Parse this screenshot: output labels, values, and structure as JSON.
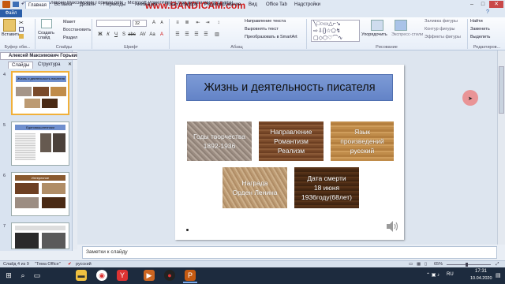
{
  "window": {
    "title": "Алексей Максимович Горький.pptx - Microsoft PowerPoint (Сбой активации продукта)",
    "watermark": "www.BANDICAM.com"
  },
  "ribbon_tabs": [
    "Файл",
    "Главная",
    "Вставка",
    "Дизайн",
    "Переходы",
    "Анимация",
    "Показ слайдов",
    "Рецензирование",
    "Вид",
    "Office Tab",
    "Надстройки"
  ],
  "ribbon": {
    "paste": "Вставить",
    "new_slide": "Создать слайд",
    "layout": "Макет",
    "reset": "Восстановить",
    "section": "Раздел",
    "font_size": "32",
    "text_direction": "Направление текста",
    "align_text": "Выровнять текст",
    "convert_smartart": "Преобразовать в SmartArt",
    "arrange": "Упорядочить",
    "quick_styles": "Экспресс-стили",
    "shape_fill": "Заливка фигуры",
    "shape_outline": "Контур фигуры",
    "shape_effects": "Эффекты фигуры",
    "find": "Найти",
    "replace": "Заменить",
    "select": "Выделить",
    "groups": [
      "Буфер обм...",
      "Слайды",
      "Шрифт",
      "Абзац",
      "Рисование",
      "Редактиров..."
    ]
  },
  "pane": {
    "author_tab": "Алексей Максимович Горький",
    "tabs": [
      "Слайды",
      "Структура"
    ],
    "thumbs": [
      {
        "num": "4",
        "title": "Жизнь и деятельность писателя",
        "selected": true
      },
      {
        "num": "5",
        "title": "Единомышленники",
        "selected": false
      },
      {
        "num": "6",
        "title": "Интересное",
        "selected": false
      },
      {
        "num": "7",
        "title": "",
        "selected": false
      }
    ]
  },
  "slide": {
    "title": "Жизнь и деятельность писателя",
    "boxes": [
      {
        "lines": [
          "Годы творчества",
          "1892-1936"
        ]
      },
      {
        "lines": [
          "Направление",
          "Романтизм",
          "Реализм"
        ]
      },
      {
        "lines": [
          "Язык",
          "произведений",
          "русский"
        ]
      },
      {
        "lines": [
          "Награда",
          "Орден Ленина"
        ]
      },
      {
        "lines": [
          "Дата смерти",
          "18 июня",
          "1936году(68лет)"
        ]
      }
    ]
  },
  "notes_placeholder": "Заметки к слайду",
  "status": {
    "slide_info": "Слайд 4 из 9",
    "theme": "\"Тема Office\"",
    "language": "русский",
    "zoom": "65%"
  },
  "taskbar": {
    "lang": "RU",
    "time": "17:31",
    "date": "10.04.2020"
  },
  "colors": {
    "title_fill": "#6f8fce",
    "accent_blue": "#2a5ea8"
  }
}
